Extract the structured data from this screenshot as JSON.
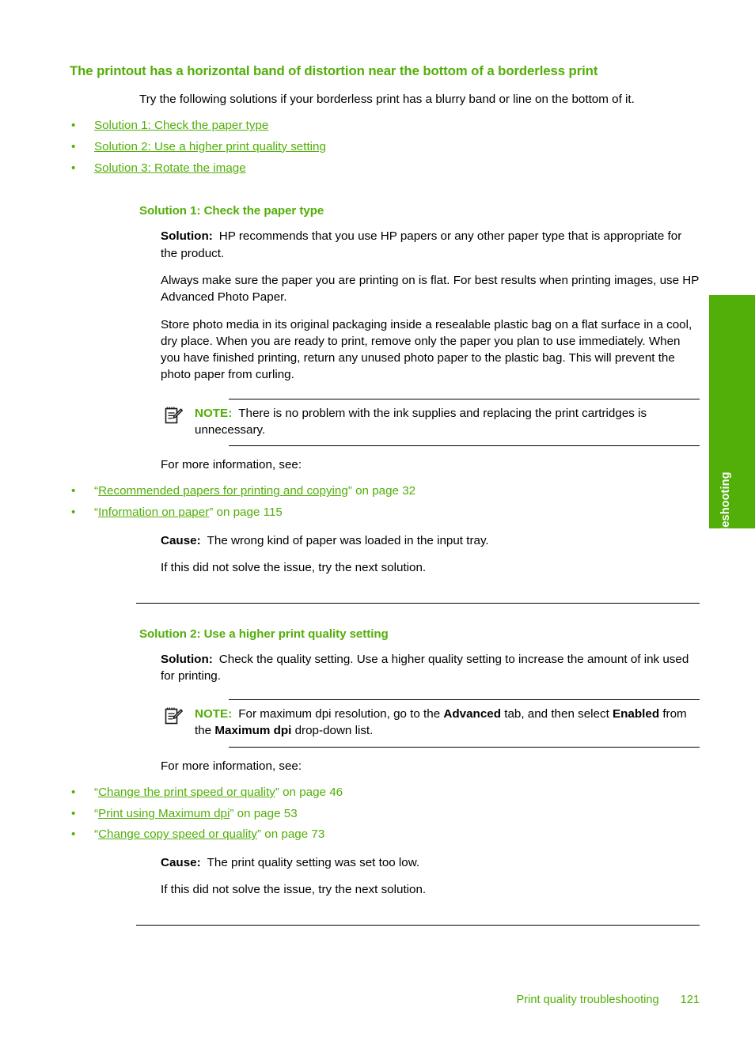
{
  "page": {
    "accent_color": "#52ae08",
    "text_color": "#000000",
    "background": "#ffffff"
  },
  "side_tab": {
    "label": "Troubleshooting"
  },
  "topic": {
    "title": "The printout has a horizontal band of distortion near the bottom of a borderless print",
    "intro": "Try the following solutions if your borderless print has a blurry band or line on the bottom of it.",
    "solution_links": [
      "Solution 1: Check the paper type",
      "Solution 2: Use a higher print quality setting",
      "Solution 3: Rotate the image"
    ]
  },
  "solution1": {
    "heading": "Solution 1: Check the paper type",
    "solution_label": "Solution:",
    "solution_text": "HP recommends that you use HP papers or any other paper type that is appropriate for the product.",
    "para2": "Always make sure the paper you are printing on is flat. For best results when printing images, use HP Advanced Photo Paper.",
    "para3": "Store photo media in its original packaging inside a resealable plastic bag on a flat surface in a cool, dry place. When you are ready to print, remove only the paper you plan to use immediately. When you have finished printing, return any unused photo paper to the plastic bag. This will prevent the photo paper from curling.",
    "note_label": "NOTE:",
    "note_text": "There is no problem with the ink supplies and replacing the print cartridges is unnecessary.",
    "more_info_label": "For more information, see:",
    "references": [
      {
        "open_quote": "“",
        "link": "Recommended papers for printing and copying",
        "close_quote": "”",
        "suffix": " on page 32"
      },
      {
        "open_quote": "“",
        "link": "Information on paper",
        "close_quote": "”",
        "suffix": " on page 115"
      }
    ],
    "cause_label": "Cause:",
    "cause_text": "The wrong kind of paper was loaded in the input tray.",
    "next_text": "If this did not solve the issue, try the next solution."
  },
  "solution2": {
    "heading": "Solution 2: Use a higher print quality setting",
    "solution_label": "Solution:",
    "solution_text": "Check the quality setting. Use a higher quality setting to increase the amount of ink used for printing.",
    "note_label": "NOTE:",
    "note_part1": "For maximum dpi resolution, go to the ",
    "note_bold1": "Advanced",
    "note_part2": " tab, and then select ",
    "note_bold2": "Enabled",
    "note_part3": " from the ",
    "note_bold3": "Maximum dpi",
    "note_part4": " drop-down list.",
    "more_info_label": "For more information, see:",
    "references": [
      {
        "open_quote": "“",
        "link": "Change the print speed or quality",
        "close_quote": "”",
        "suffix": " on page 46"
      },
      {
        "open_quote": "“",
        "link": "Print using Maximum dpi",
        "close_quote": "”",
        "suffix": " on page 53"
      },
      {
        "open_quote": "“",
        "link": "Change copy speed or quality",
        "close_quote": "”",
        "suffix": " on page 73"
      }
    ],
    "cause_label": "Cause:",
    "cause_text": "The print quality setting was set too low.",
    "next_text": "If this did not solve the issue, try the next solution."
  },
  "footer": {
    "section": "Print quality troubleshooting",
    "page_number": "121"
  },
  "icons": {
    "note": "note-pencil-icon",
    "bullet": "•"
  }
}
